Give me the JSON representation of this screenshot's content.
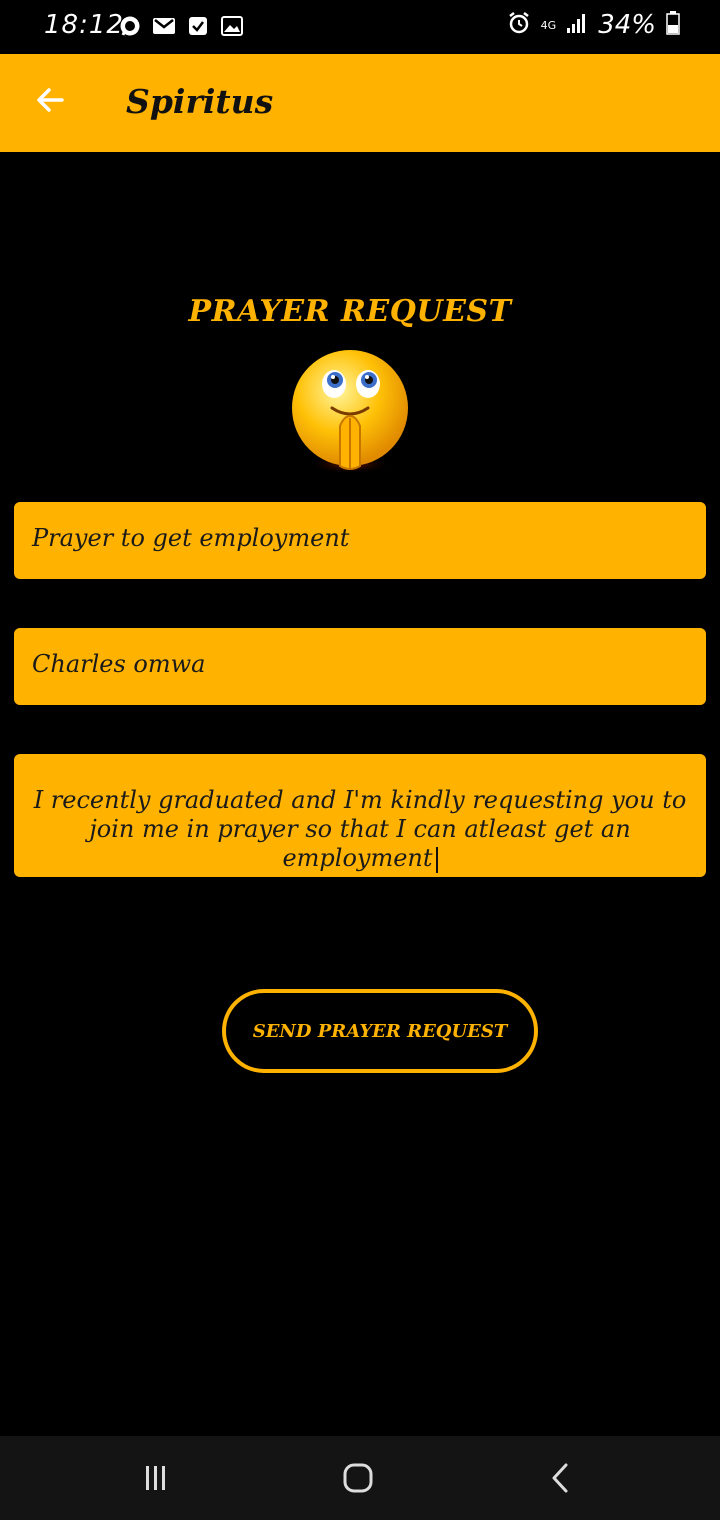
{
  "status_bar": {
    "time": "18:12",
    "network": "4G",
    "battery": "34%",
    "icons": [
      "whatsapp-icon",
      "gmail-icon",
      "checkbox-icon",
      "gallery-icon",
      "alarm-icon",
      "signal-icon",
      "battery-icon"
    ]
  },
  "app_bar": {
    "title": "Spiritus",
    "back_icon": "arrow-left-icon"
  },
  "form": {
    "heading": "PRAYER REQUEST",
    "emoji": "praying-smiley-icon",
    "subject_value": "Prayer to get employment",
    "name_value": "Charles omwa",
    "message_value": "I recently graduated and I'm kindly requesting you to join me in prayer so that I can atleast get an employment",
    "send_label": "SEND PRAYER REQUEST"
  },
  "nav_bar": {
    "recents_icon": "recents-icon",
    "home_icon": "home-icon",
    "back_icon": "back-chevron-icon"
  },
  "colors": {
    "accent": "#ffb300",
    "background": "#000000",
    "navbar": "#141414"
  }
}
